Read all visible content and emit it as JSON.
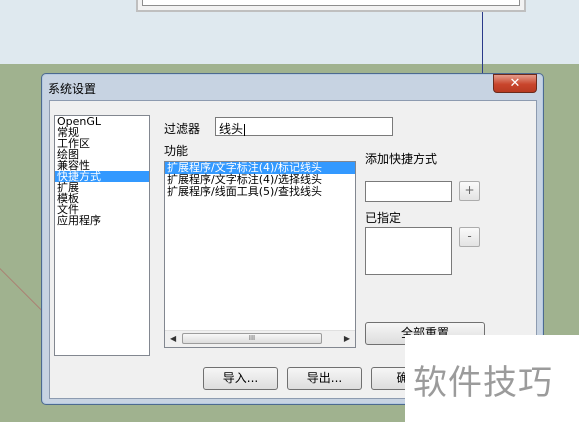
{
  "dialog": {
    "title": "系统设置",
    "close_symbol": "✕"
  },
  "categories": [
    {
      "label": "OpenGL",
      "selected": false
    },
    {
      "label": "常规",
      "selected": false
    },
    {
      "label": "工作区",
      "selected": false
    },
    {
      "label": "绘图",
      "selected": false
    },
    {
      "label": "兼容性",
      "selected": false
    },
    {
      "label": "快捷方式",
      "selected": true
    },
    {
      "label": "扩展",
      "selected": false
    },
    {
      "label": "模板",
      "selected": false
    },
    {
      "label": "文件",
      "selected": false
    },
    {
      "label": "应用程序",
      "selected": false
    }
  ],
  "filter": {
    "label": "过滤器",
    "value": "线头"
  },
  "functions": {
    "label": "功能",
    "items": [
      {
        "label": "扩展程序/文字标注(4)/标记线头",
        "selected": true
      },
      {
        "label": "扩展程序/文字标注(4)/选择线头",
        "selected": false
      },
      {
        "label": "扩展程序/线面工具(5)/查找线头",
        "selected": false
      }
    ],
    "scroll_left": "◀",
    "scroll_right": "▶",
    "scroll_grip": "III"
  },
  "shortcut": {
    "add_label": "添加快捷方式",
    "add_button": "+",
    "assigned_label": "已指定",
    "remove_button": "-",
    "reset_all_button": "全部重置"
  },
  "footer": {
    "import_button": "导入...",
    "export_button": "导出...",
    "ok_button": "确定"
  },
  "watermark": "软件技巧",
  "colors": {
    "selection": "#3399ff",
    "close_button": "#c8452c",
    "dialog_frame": "#c7d3e2"
  }
}
